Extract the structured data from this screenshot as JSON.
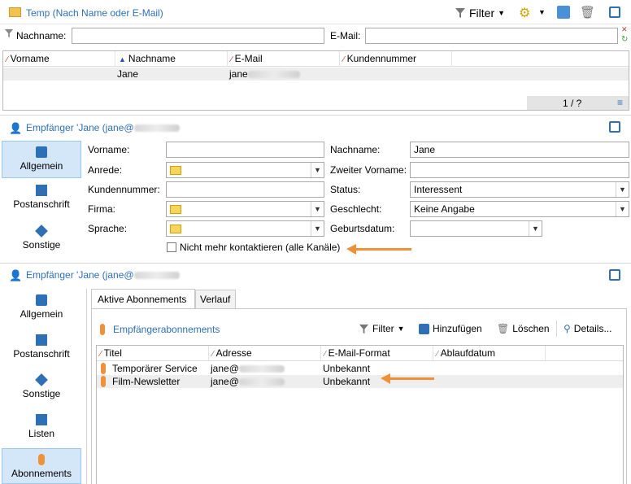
{
  "top_panel": {
    "title": "Temp (Nach Name oder E-Mail)",
    "filter_label": "Filter",
    "search_labels": {
      "name": "Nachname:",
      "email": "E-Mail:"
    },
    "search_values": {
      "name": "",
      "email": ""
    },
    "columns": [
      "Vorname",
      "Nachname",
      "E-Mail",
      "Kundennummer"
    ],
    "row": {
      "first": "",
      "last": "Jane",
      "email": "jane"
    },
    "pagination": "1 / ?"
  },
  "recipient_panel": {
    "title": "Empfänger 'Jane  (jane@",
    "nav": [
      "Allgemein",
      "Postanschrift",
      "Sonstige"
    ],
    "fields": {
      "vorname_label": "Vorname:",
      "vorname_value": "",
      "nachname_label": "Nachname:",
      "nachname_value": "Jane",
      "anrede_label": "Anrede:",
      "zweiter_label": "Zweiter Vorname:",
      "zweiter_value": "",
      "kunden_label": "Kundennummer:",
      "kunden_value": "",
      "status_label": "Status:",
      "status_value": "Interessent",
      "firma_label": "Firma:",
      "geschlecht_label": "Geschlecht:",
      "geschlecht_value": "Keine Angabe",
      "sprache_label": "Sprache:",
      "geburt_label": "Geburtsdatum:",
      "geburt_value": ""
    },
    "checkbox_label": "Nicht mehr kontaktieren (alle Kanäle)"
  },
  "subscriptions_panel": {
    "title": "Empfänger 'Jane  (jane@",
    "nav": [
      "Allgemein",
      "Postanschrift",
      "Sonstige",
      "Listen",
      "Abonnements"
    ],
    "tabs": [
      "Aktive Abonnements",
      "Verlauf"
    ],
    "sub_title": "Empfängerabonnements",
    "toolbar": {
      "filter": "Filter",
      "add": "Hinzufügen",
      "delete": "Löschen",
      "details": "Details..."
    },
    "columns": [
      "Titel",
      "Adresse",
      "E-Mail-Format",
      "Ablaufdatum"
    ],
    "rows": [
      {
        "title": "Temporärer Service",
        "address": "jane@",
        "format": "Unbekannt",
        "expiry": ""
      },
      {
        "title": "Film-Newsletter",
        "address": "jane@",
        "format": "Unbekannt",
        "expiry": ""
      }
    ]
  },
  "colors": {
    "accent": "#2f6fb5",
    "highlight": "#f0913a",
    "nav_active": "#d4e7f8"
  }
}
